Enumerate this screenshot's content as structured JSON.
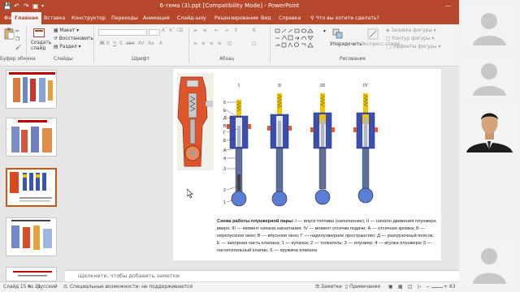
{
  "window": {
    "title": "6-тема (3).ppt [Compatibility Mode] - PowerPoint",
    "quick_access": [
      "save",
      "undo",
      "redo",
      "start-slideshow"
    ]
  },
  "tabs": [
    "Файл",
    "Главная",
    "Вставка",
    "Конструктор",
    "Переходы",
    "Анимация",
    "Слайд-шоу",
    "Рецензирование",
    "Вид",
    "Справка"
  ],
  "active_tab": "Главная",
  "tell_me": "Что вы хотите сделать?",
  "ribbon": {
    "clipboard": {
      "paste": "Вставить",
      "cut": "",
      "copy": "",
      "format_painter": "",
      "label": "Буфер обмена"
    },
    "slides": {
      "new_slide": "Создать слайд",
      "layout": "Макет",
      "reset": "Восстановить",
      "section": "Раздел",
      "label": "Слайды"
    },
    "font": {
      "label": "Шрифт"
    },
    "paragraph": {
      "label": "Абзац"
    },
    "drawing": {
      "arrange": "Упорядочить",
      "quick_styles": "Экспресс-стили",
      "fill": "Заливка фигуры",
      "outline": "Контур фигуры",
      "effects": "Эффекты фигуры",
      "label": "Рисование"
    }
  },
  "slide": {
    "column_labels": [
      "I",
      "II",
      "III",
      "IV"
    ],
    "left_labels": [
      "6",
      "Е",
      "Д",
      "В",
      "Г",
      "Б",
      "А",
      "4",
      "3",
      "2",
      "1"
    ],
    "caption_title": "Схема работы плунжерной пары:",
    "caption_body": "I — впуск топлива (наполнение); II — начало движения плунжера вверх; III — момент начала нагнетания; IV — момент отсечки подачи; А — отсечная кромка; Б — перепускное окно; В — впускное окно; Г — надплунжерное пространство; Д — разгрузочный поясок; Е — запорная часть клапана; 1 — кулачок; 2 — толкатель; 3 — плунжер; 4 — втулка плунжера; 5 — нагнетательный клапан; 6 — пружина клапана"
  },
  "notes_placeholder": "Щелкните, чтобы добавить заметки",
  "status": {
    "slide": "Слайд 15 из 21",
    "language": "русский",
    "accessibility": "Специальные возможности: не поддерживаются",
    "notes": "Заметки",
    "comments": "Примечания",
    "zoom": "63"
  },
  "colors": {
    "brand": "#b7472a",
    "selected_thumb": "#c55a11"
  }
}
